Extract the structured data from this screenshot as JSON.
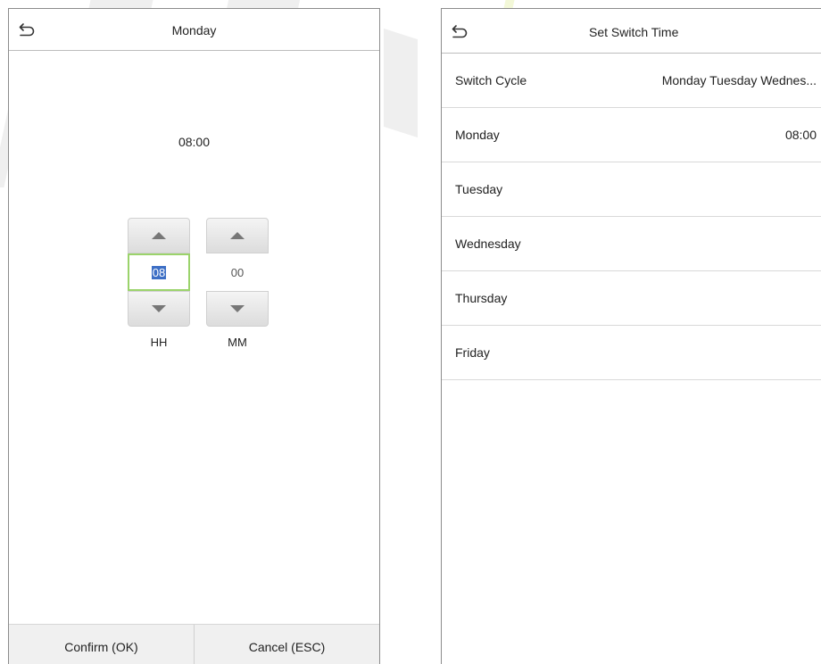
{
  "time_picker": {
    "title": "Monday",
    "time_display": "08:00",
    "hours": {
      "value": "08",
      "label": "HH"
    },
    "minutes": {
      "value": "00",
      "label": "MM"
    },
    "confirm_label": "Confirm (OK)",
    "cancel_label": "Cancel (ESC)"
  },
  "switch_time": {
    "title": "Set Switch Time",
    "rows": [
      {
        "label": "Switch Cycle",
        "value": "Monday Tuesday Wednes..."
      },
      {
        "label": "Monday",
        "value": "08:00"
      },
      {
        "label": "Tuesday",
        "value": ""
      },
      {
        "label": "Wednesday",
        "value": ""
      },
      {
        "label": "Thursday",
        "value": ""
      },
      {
        "label": "Friday",
        "value": ""
      }
    ]
  },
  "colors": {
    "active_field_border": "#9bd36b",
    "selection_highlight": "#3d6fc5",
    "footer_bg": "#f0f0f0"
  },
  "icons": [
    "back-arrow-icon",
    "chevron-up-icon",
    "chevron-down-icon"
  ]
}
